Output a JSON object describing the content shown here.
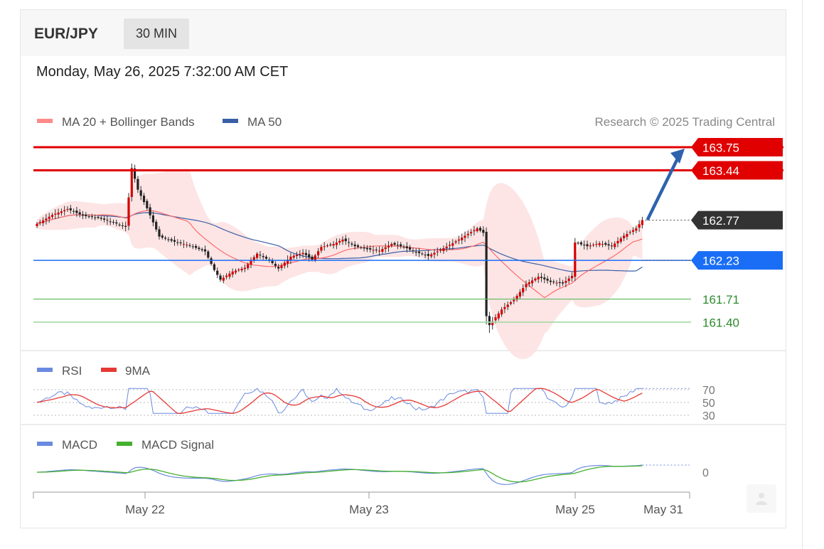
{
  "header": {
    "pair": "EUR/JPY",
    "interval": "30 MIN"
  },
  "timestamp": "Monday, May 26, 2025 7:32:00 AM CET",
  "legend": {
    "ma20": "MA 20 + Bollinger Bands",
    "ma50": "MA 50",
    "credit": "Research © 2025 Trading Central"
  },
  "rsi_legend": {
    "rsi": "RSI",
    "ma9": "9MA"
  },
  "macd_legend": {
    "macd": "MACD",
    "signal": "MACD Signal"
  },
  "colors": {
    "up": "#d50000",
    "down": "#222222",
    "ma20": "#ff6b6b",
    "ma50": "#3a5fa8",
    "band": "#fde0e0",
    "resistance": "#e00000",
    "pivot": "#1a6ef5",
    "support": "#5cb85c",
    "support2": "#a9dba9",
    "current": "#333333",
    "arrow": "#2e62ad",
    "rsi": "#6a8ae0",
    "rsi_ma": "#e53935",
    "macd": "#6a8ae0",
    "macd_signal": "#45b030"
  },
  "chart_data": {
    "type": "candlestick",
    "x_labels": [
      "May 22",
      "May 23",
      "May 25",
      "May 31"
    ],
    "ylim": [
      161.1,
      164.0
    ],
    "levels": [
      {
        "value": 163.75,
        "label": "163.75",
        "kind": "resistance"
      },
      {
        "value": 163.44,
        "label": "163.44",
        "kind": "resistance"
      },
      {
        "value": 162.77,
        "label": "162.77",
        "kind": "current"
      },
      {
        "value": 162.23,
        "label": "162.23",
        "kind": "pivot"
      },
      {
        "value": 161.71,
        "label": "161.71",
        "kind": "support"
      },
      {
        "value": 161.4,
        "label": "161.40",
        "kind": "support2"
      }
    ],
    "projection": {
      "from": 162.77,
      "to": 163.75
    },
    "candle_anchors": [
      [
        0,
        162.72
      ],
      [
        5,
        162.84
      ],
      [
        10,
        162.92
      ],
      [
        15,
        162.83
      ],
      [
        20,
        162.8
      ],
      [
        25,
        162.74
      ],
      [
        29,
        162.68
      ],
      [
        31,
        163.47
      ],
      [
        33,
        163.18
      ],
      [
        36,
        162.93
      ],
      [
        40,
        162.55
      ],
      [
        45,
        162.48
      ],
      [
        50,
        162.43
      ],
      [
        55,
        162.35
      ],
      [
        58,
        162.1
      ],
      [
        60,
        161.97
      ],
      [
        64,
        162.08
      ],
      [
        68,
        162.13
      ],
      [
        72,
        162.32
      ],
      [
        76,
        162.23
      ],
      [
        79,
        162.12
      ],
      [
        83,
        162.28
      ],
      [
        87,
        162.33
      ],
      [
        90,
        162.24
      ],
      [
        93,
        162.41
      ],
      [
        97,
        162.45
      ],
      [
        100,
        162.51
      ],
      [
        104,
        162.42
      ],
      [
        108,
        162.38
      ],
      [
        112,
        162.36
      ],
      [
        116,
        162.45
      ],
      [
        120,
        162.41
      ],
      [
        124,
        162.34
      ],
      [
        128,
        162.29
      ],
      [
        132,
        162.37
      ],
      [
        136,
        162.46
      ],
      [
        140,
        162.56
      ],
      [
        144,
        162.66
      ],
      [
        146,
        162.6
      ],
      [
        147,
        161.48
      ],
      [
        148,
        161.36
      ],
      [
        152,
        161.57
      ],
      [
        156,
        161.7
      ],
      [
        160,
        161.91
      ],
      [
        164,
        162.01
      ],
      [
        168,
        161.94
      ],
      [
        172,
        161.92
      ],
      [
        175,
        162.02
      ],
      [
        176,
        162.47
      ],
      [
        180,
        162.42
      ],
      [
        184,
        162.46
      ],
      [
        188,
        162.42
      ],
      [
        192,
        162.56
      ],
      [
        196,
        162.66
      ],
      [
        198,
        162.77
      ]
    ],
    "rsi": {
      "levels": [
        70,
        50,
        30
      ],
      "ylim": [
        25,
        75
      ]
    },
    "macd": {
      "levels": [
        0
      ],
      "ylim": [
        -0.25,
        0.15
      ]
    }
  }
}
